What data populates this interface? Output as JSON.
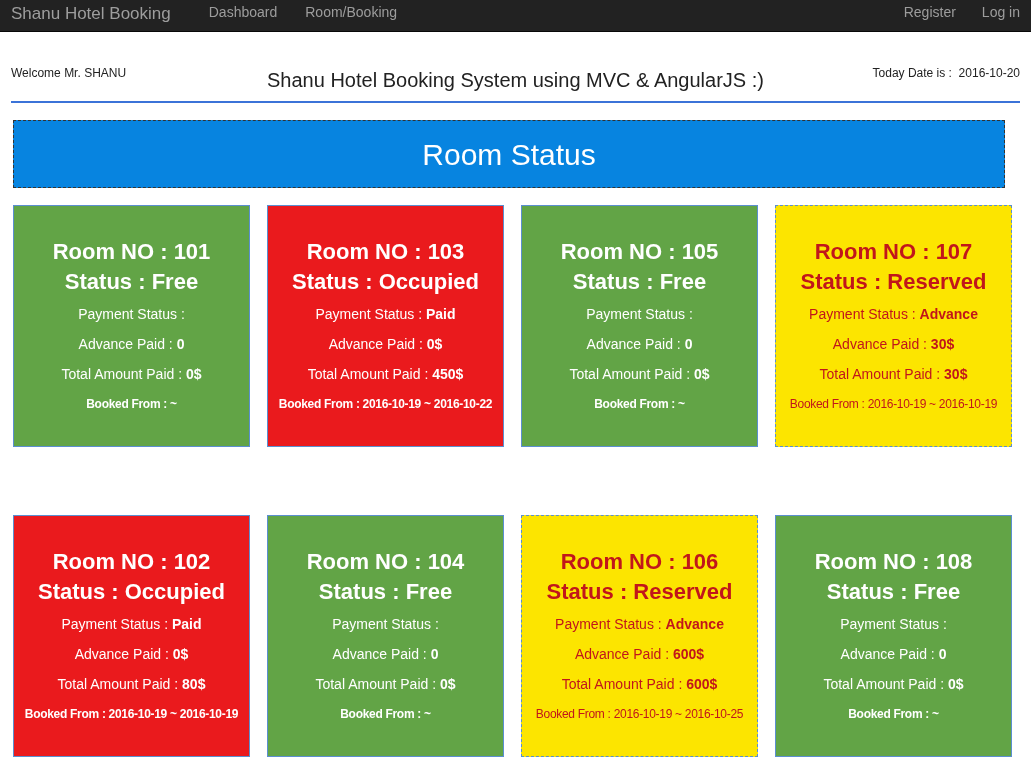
{
  "navbar": {
    "brand": "Shanu Hotel Booking",
    "links": [
      "Dashboard",
      "Room/Booking"
    ],
    "right_links": [
      "Register",
      "Log in"
    ]
  },
  "header": {
    "welcome": "Welcome Mr. SHANU",
    "title": "Shanu Hotel Booking System using MVC & AngularJS :)",
    "date": "Today Date is :  2016-10-20"
  },
  "banner": {
    "title": "Room Status"
  },
  "rooms": [
    {
      "kind": "free",
      "room": "Room NO : 101",
      "status": "Status : Free",
      "payment": "Payment Status :",
      "advance": "Advance Paid : **0**",
      "total": "Total Amount Paid : **0$**",
      "booked": "Booked From : ~"
    },
    {
      "kind": "occupied",
      "room": "Room NO : 103",
      "status": "Status : Occupied",
      "payment": "Payment Status : **Paid**",
      "advance": "Advance Paid : **0$**",
      "total": "Total Amount Paid : **450$**",
      "booked": "Booked From : 2016-10-19 ~ 2016-10-22"
    },
    {
      "kind": "free",
      "room": "Room NO : 105",
      "status": "Status : Free",
      "payment": "Payment Status :",
      "advance": "Advance Paid : **0**",
      "total": "Total Amount Paid : **0$**",
      "booked": "Booked From : ~"
    },
    {
      "kind": "reserved",
      "room": "Room NO : 107",
      "status": "Status : Reserved",
      "payment": "Payment Status : **Advance**",
      "advance": "Advance Paid : **30$**",
      "total": "Total Amount Paid : **30$**",
      "booked": "Booked From : 2016-10-19 ~ 2016-10-19"
    },
    {
      "kind": "occupied",
      "room": "Room NO : 102",
      "status": "Status : Occupied",
      "payment": "Payment Status : **Paid**",
      "advance": "Advance Paid : **0$**",
      "total": "Total Amount Paid : **80$**",
      "booked": "Booked From : 2016-10-19 ~ 2016-10-19"
    },
    {
      "kind": "free",
      "room": "Room NO : 104",
      "status": "Status : Free",
      "payment": "Payment Status :",
      "advance": "Advance Paid : **0**",
      "total": "Total Amount Paid : **0$**",
      "booked": "Booked From : ~"
    },
    {
      "kind": "reserved",
      "room": "Room NO : 106",
      "status": "Status : Reserved",
      "payment": "Payment Status : **Advance**",
      "advance": "Advance Paid : **600$**",
      "total": "Total Amount Paid : **600$**",
      "booked": "Booked From : 2016-10-19 ~ 2016-10-25"
    },
    {
      "kind": "free",
      "room": "Room NO : 108",
      "status": "Status : Free",
      "payment": "Payment Status :",
      "advance": "Advance Paid : **0**",
      "total": "Total Amount Paid : **0$**",
      "booked": "Booked From : ~"
    }
  ]
}
